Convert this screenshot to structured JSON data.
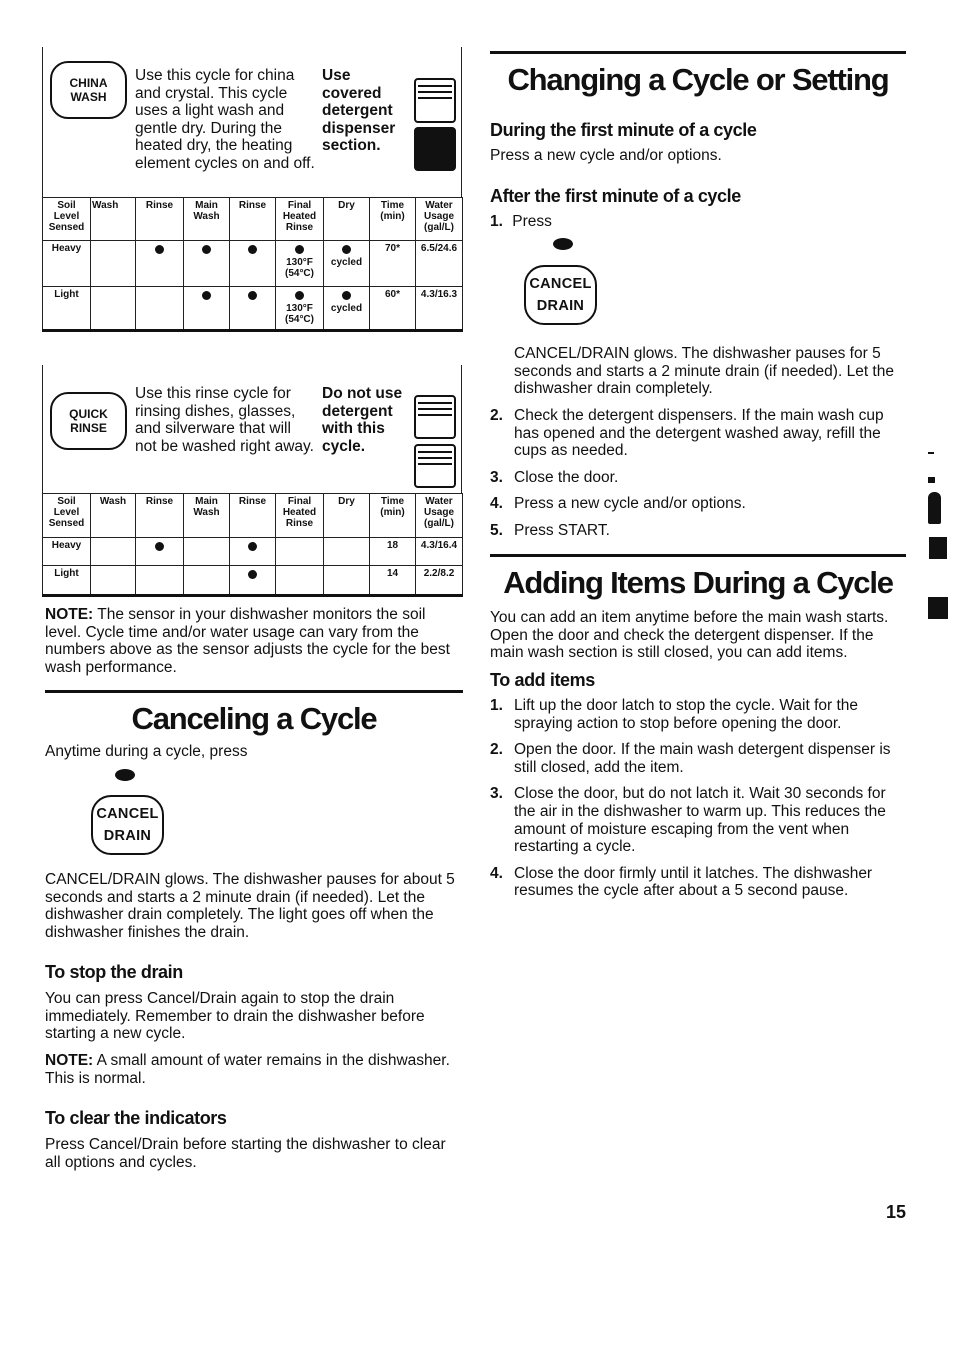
{
  "china_wash": {
    "button_line1": "CHINA",
    "button_line2": "WASH",
    "description": "Use this cycle for china and crystal. This cycle uses a light wash and gentle dry. During the heated dry, the heating element cycles on and off.",
    "detergent_note": "Use covered detergent dispenser section.",
    "icon": "detergent-dispenser-covered-filled-icon"
  },
  "china_wash_table": {
    "headers": [
      "Soil Level Sensed",
      "Wash",
      "Rinse",
      "Main Wash",
      "Rinse",
      "Final Heated Rinse",
      "Dry",
      "Time (min)",
      "Water Usage (gal/L)"
    ],
    "rows": [
      {
        "level": "Heavy",
        "wash": "",
        "rinse1": "●",
        "main_wash": "●",
        "rinse2": "●",
        "final_heated_rinse": "●",
        "final_heated_rinse_note": "130°F (54°C)",
        "dry": "●",
        "dry_note": "cycled",
        "time": "70*",
        "water": "6.5/24.6"
      },
      {
        "level": "Light",
        "wash": "",
        "rinse1": "",
        "main_wash": "●",
        "rinse2": "●",
        "final_heated_rinse": "●",
        "final_heated_rinse_note": "130°F (54°C)",
        "dry": "●",
        "dry_note": "cycled",
        "time": "60*",
        "water": "4.3/16.3"
      }
    ]
  },
  "quick_rinse": {
    "button_line1": "QUICK",
    "button_line2": "RINSE",
    "description": "Use this rinse cycle for rinsing dishes, glasses, and silverware that will not be washed right away.",
    "detergent_note": "Do not use detergent with this cycle.",
    "icon": "detergent-dispenser-empty-icon"
  },
  "quick_rinse_table": {
    "headers": [
      "Soil Level Sensed",
      "Wash",
      "Rinse",
      "Main Wash",
      "Rinse",
      "Final Heated Rinse",
      "Dry",
      "Time (min)",
      "Water Usage (gal/L)"
    ],
    "rows": [
      {
        "level": "Heavy",
        "wash": "",
        "rinse1": "●",
        "main_wash": "",
        "rinse2": "●",
        "final_heated_rinse": "",
        "dry": "",
        "time": "18",
        "water": "4.3/16.4"
      },
      {
        "level": "Light",
        "wash": "",
        "rinse1": "",
        "main_wash": "",
        "rinse2": "●",
        "final_heated_rinse": "",
        "dry": "",
        "time": "14",
        "water": "2.2/8.2"
      }
    ]
  },
  "sensor_note": {
    "label": "NOTE:",
    "text": " The sensor in your dishwasher monitors the soil level. Cycle time and/or water usage can vary from the numbers above as the sensor adjusts the cycle for the best wash performance."
  },
  "canceling": {
    "title": "Canceling a Cycle",
    "intro": "Anytime during a cycle, press",
    "button_line1": "CANCEL",
    "button_line2": "DRAIN",
    "after": "CANCEL/DRAIN glows. The dishwasher pauses for about 5 seconds and starts a 2 minute drain (if needed). Let the dishwasher drain completely. The light goes off when the dishwasher finishes the drain.",
    "stop_drain_title": "To stop the drain",
    "stop_drain_text": "You can press Cancel/Drain again to stop the drain immediately. Remember to drain the dishwasher before starting a new cycle.",
    "stop_note_label": "NOTE:",
    "stop_note_text": " A small amount of water remains in the dishwasher. This is normal.",
    "clear_title": "To clear the indicators",
    "clear_text": "Press Cancel/Drain before starting the dishwasher to clear all options and cycles."
  },
  "changing": {
    "title": "Changing a Cycle or Setting",
    "during_title": "During the first minute of a cycle",
    "during_text": "Press a new cycle and/or options.",
    "after_title": "After the first minute of a cycle",
    "step1_num": "1.",
    "step1_text": "Press",
    "button_line1": "CANCEL",
    "button_line2": "DRAIN",
    "step1_after": "CANCEL/DRAIN glows. The dishwasher pauses for 5 seconds and starts a 2 minute drain (if needed). Let the dishwasher drain completely.",
    "steps": [
      {
        "num": "2.",
        "text": "Check the detergent dispensers. If the main wash cup has opened and the detergent washed away, refill the cups as needed."
      },
      {
        "num": "3.",
        "text": "Close the door."
      },
      {
        "num": "4.",
        "text": "Press a new cycle and/or options."
      },
      {
        "num": "5.",
        "text": "Press START."
      }
    ]
  },
  "adding": {
    "title": "Adding Items During a Cycle",
    "intro": "You can add an item anytime before the main wash starts. Open the door and check the detergent dispenser. If the main wash section is still closed, you can add items.",
    "subtitle": "To add items",
    "steps": [
      {
        "num": "1.",
        "text": "Lift up the door latch to stop the cycle. Wait for the spraying action to stop before opening the door."
      },
      {
        "num": "2.",
        "text": "Open the door. If the main wash detergent dispenser is still closed, add the item."
      },
      {
        "num": "3.",
        "text": "Close the door, but do not latch it. Wait 30 seconds for the air in the dishwasher to warm up. This reduces the amount of moisture escaping from the vent when restarting a cycle."
      },
      {
        "num": "4.",
        "text": "Close the door firmly until it latches. The dishwasher resumes the cycle after about a 5 second pause."
      }
    ]
  },
  "page_number": "15"
}
